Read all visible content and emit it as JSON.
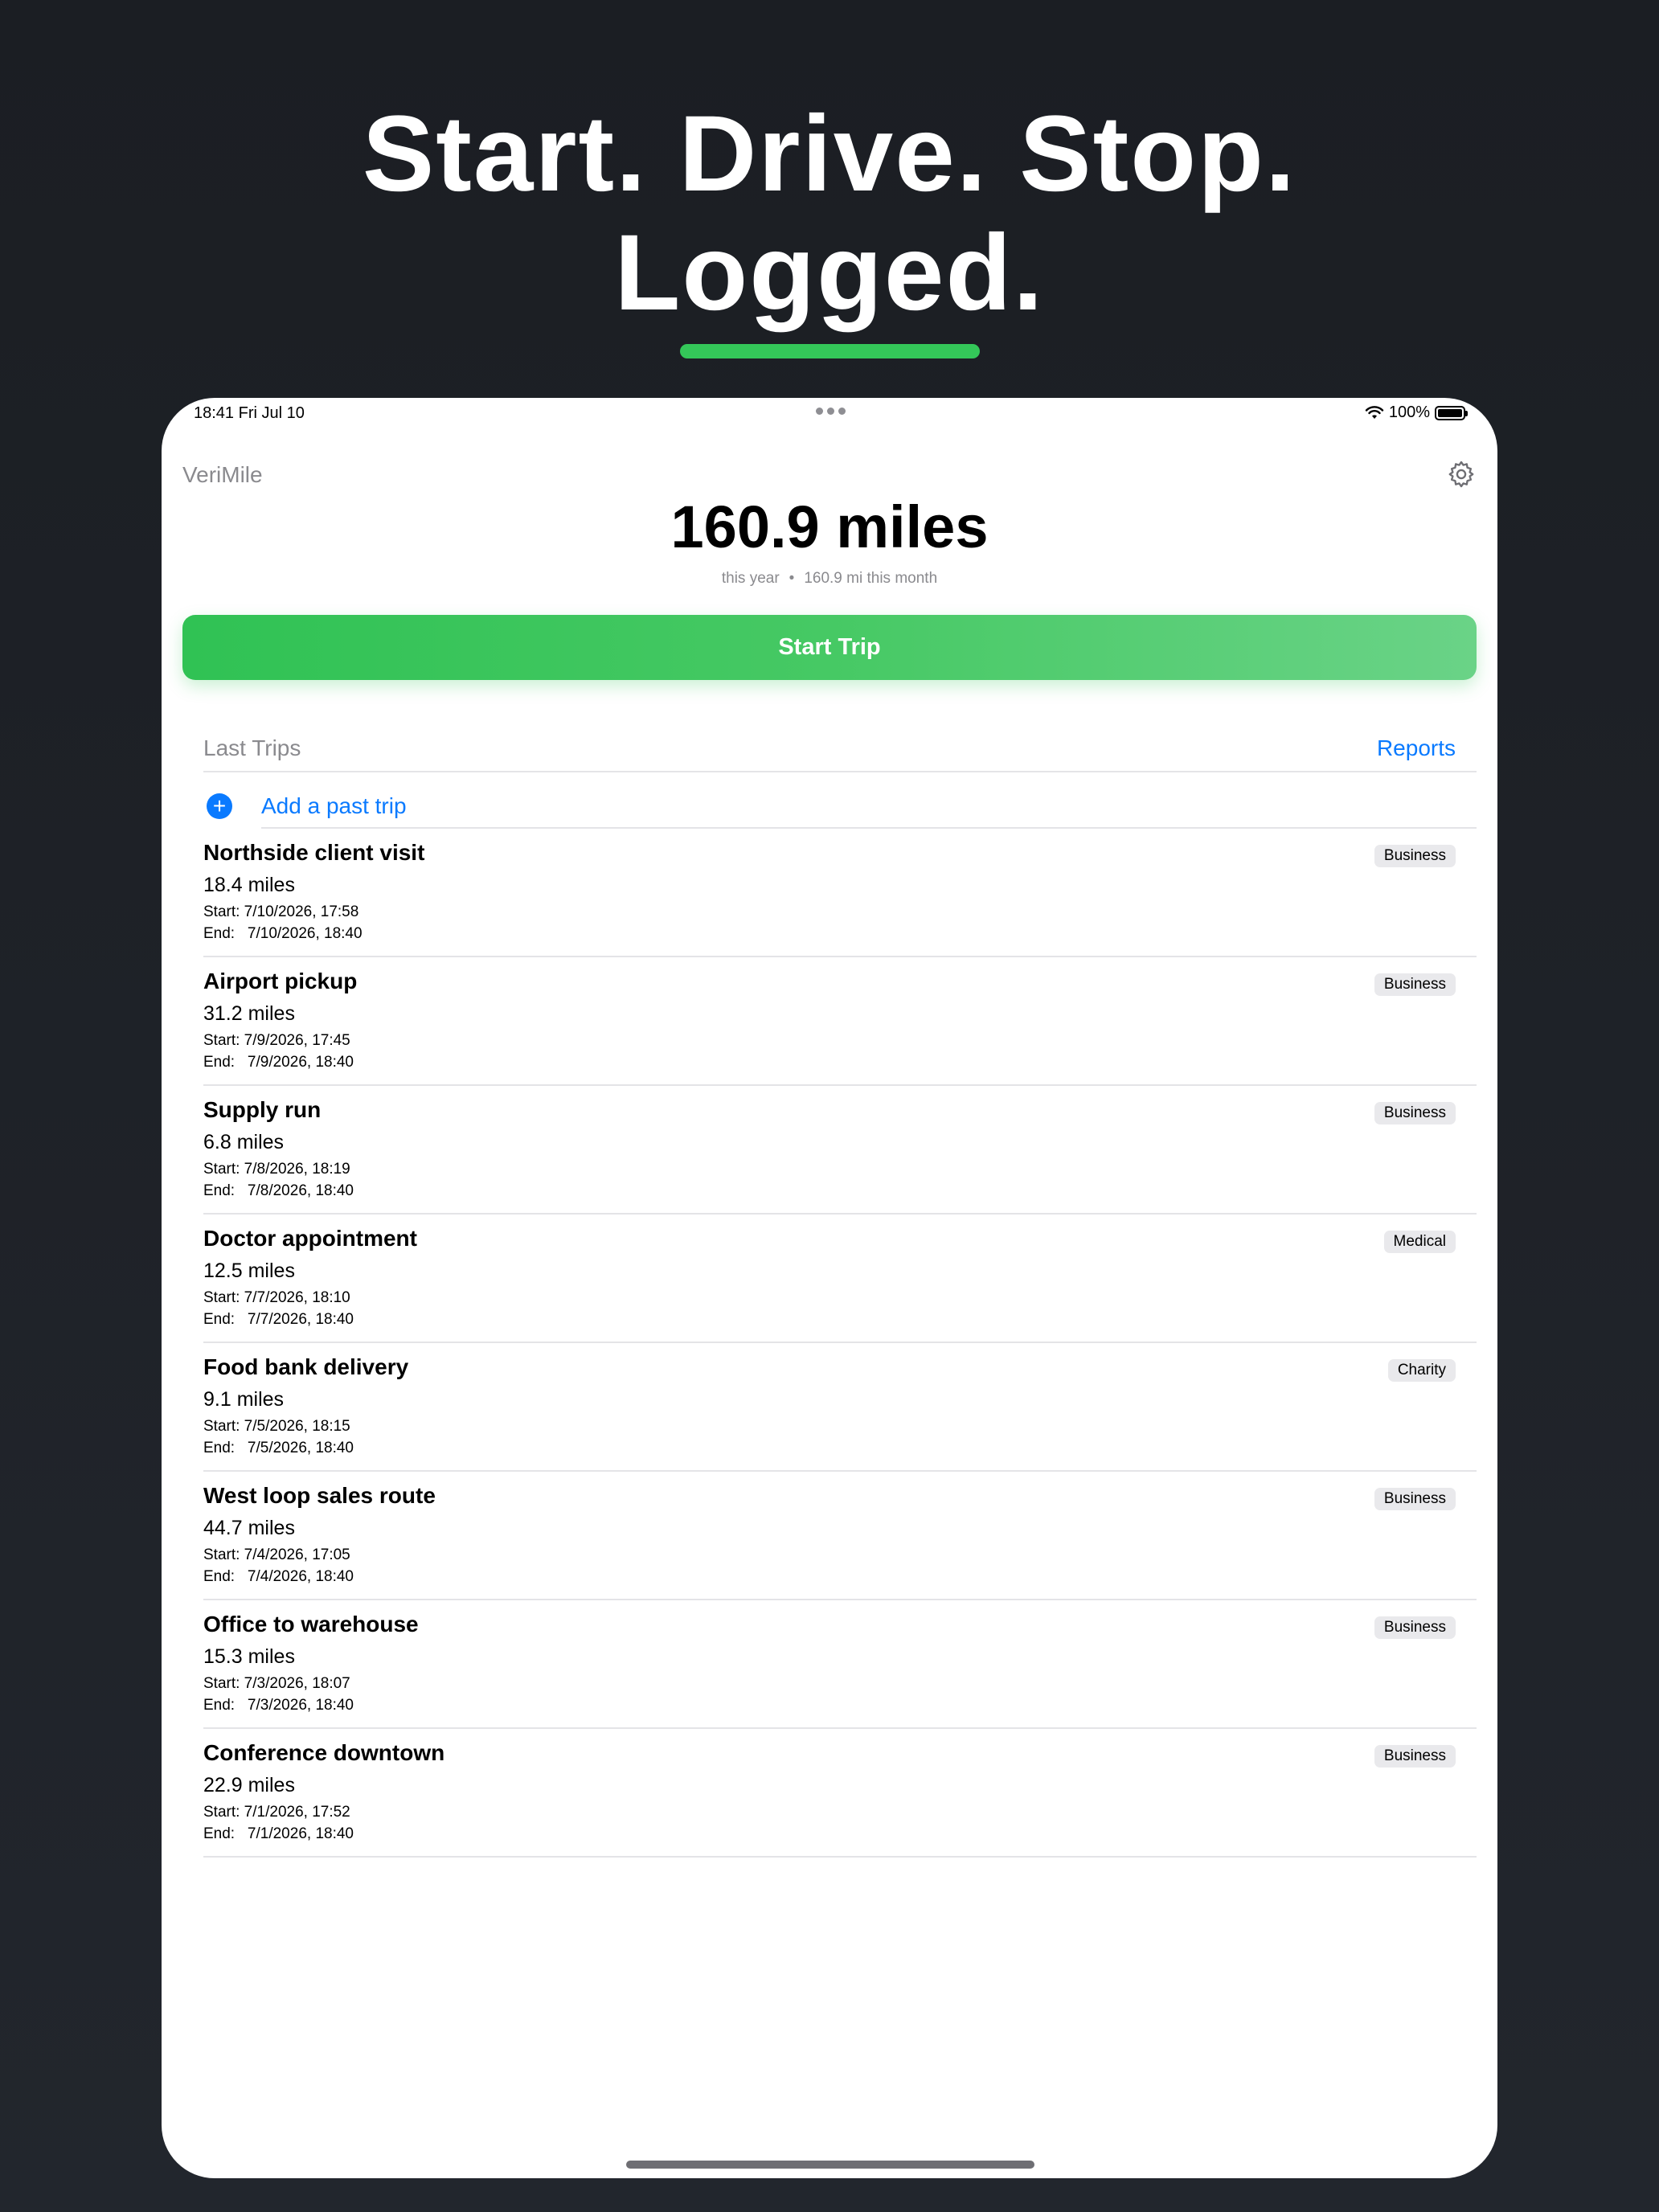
{
  "headline": {
    "line1": "Start. Drive. Stop.",
    "line2": "Logged."
  },
  "colors": {
    "accent": "#34c759",
    "link": "#0a7aff"
  },
  "status_bar": {
    "time_date": "18:41   Fri Jul 10",
    "battery": "100%"
  },
  "app": {
    "name": "VeriMile",
    "total": "160.9 miles",
    "period": "this year",
    "month": "160.9 mi this month",
    "start_button": "Start Trip"
  },
  "list": {
    "title": "Last Trips",
    "reports": "Reports",
    "add_label": "Add a past trip",
    "trips": [
      {
        "name": "Northside client visit",
        "miles": "18.4 miles",
        "start": "Start: 7/10/2026, 17:58",
        "end": "End:   7/10/2026, 18:40",
        "category": "Business"
      },
      {
        "name": "Airport pickup",
        "miles": "31.2 miles",
        "start": "Start: 7/9/2026, 17:45",
        "end": "End:   7/9/2026, 18:40",
        "category": "Business"
      },
      {
        "name": "Supply run",
        "miles": "6.8 miles",
        "start": "Start: 7/8/2026, 18:19",
        "end": "End:   7/8/2026, 18:40",
        "category": "Business"
      },
      {
        "name": "Doctor appointment",
        "miles": "12.5 miles",
        "start": "Start: 7/7/2026, 18:10",
        "end": "End:   7/7/2026, 18:40",
        "category": "Medical"
      },
      {
        "name": "Food bank delivery",
        "miles": "9.1 miles",
        "start": "Start: 7/5/2026, 18:15",
        "end": "End:   7/5/2026, 18:40",
        "category": "Charity"
      },
      {
        "name": "West loop sales route",
        "miles": "44.7 miles",
        "start": "Start: 7/4/2026, 17:05",
        "end": "End:   7/4/2026, 18:40",
        "category": "Business"
      },
      {
        "name": "Office to warehouse",
        "miles": "15.3 miles",
        "start": "Start: 7/3/2026, 18:07",
        "end": "End:   7/3/2026, 18:40",
        "category": "Business"
      },
      {
        "name": "Conference downtown",
        "miles": "22.9 miles",
        "start": "Start: 7/1/2026, 17:52",
        "end": "End:   7/1/2026, 18:40",
        "category": "Business"
      }
    ]
  }
}
